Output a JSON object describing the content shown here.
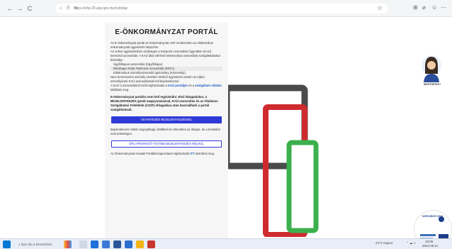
{
  "browser": {
    "back": "←",
    "forward": "→",
    "reload": "C",
    "url": "https://ohp-20.asp.lgov.hu/nyitolap",
    "addr_icons": "⌂ ⓐ ≡"
  },
  "card": {
    "title": "E-ÖNKORMÁNYZAT PORTÁL",
    "intro": "Az E-önkormányzat portál az önkormányzati ASP rendszerben az elektronikus önkormányzati ügyintézés helyszíne.",
    "auth_intro": "Az online ügyintézéshez szükséges a Központi Azonosítási Ügynökön (KAÜ) keresztül azonosítás. A KAÜ által elérhető elektronikus azonosítási szolgáltatásokat biztosítja:",
    "methods": [
      "Ügyfélkapus azonosítás (Ügyfélkapu)",
      "Részleges Kódú Telefonos Azonosítás (RKTA)",
      "Elektronikus személyazonosító igazolvány (eSzemélyi)."
    ],
    "note": "Nem természetes személy nevében történő ügyintézés esetén az eljáró személyének KAÜ-azonosítással kell bejelentkeznie.",
    "kau_info_prefix": "A KAÜ-s azonosításról szóló tájékoztatás a",
    "kau_link1": "KAÜ portálján",
    "kau_mid": "és a",
    "kau_link2": "szolgáltató oldalán",
    "kau_suffix": "található meg.",
    "bold_notice": "E-önkormányzat portálra nem kell regisztrálni. Első látogatáskor, a BEJELENTKEZÉS gomb megnyomásával, KAÜ azonosítás és az Általános Szolgáltatási Feltételek (ÁSZF) elfogadása után használható a portál szolgáltatásait.",
    "login_button": "ÜGYINTÉZÉS BEJELENTKEZÉSSEL",
    "no_login_text": "Bejelentkezés nélkül megnyithatja, kitöltheti és elmentheti az űrlapot, de a beküldés nem lehetséges.",
    "no_login_button": "ŰRLAPKERESŐ TOVÁBB BEJELENTKEZÉS NÉLKÜL",
    "footer_prefix": "Az Önkormányzati Hivatali Portállal kapcsolatos tájékoztatót",
    "footer_link": "ITT",
    "footer_suffix": "tekintheti meg."
  },
  "assistant": {
    "label": "SEGÍTHETEK?"
  },
  "logo": {
    "label": "SZÉCHENYI 2020"
  },
  "taskbar": {
    "search_placeholder": "Írjon ide a kereséshez",
    "weather": "24°C Napos",
    "time": "10:05",
    "date": "2022.08.11."
  },
  "colors": {
    "accent": "#2f3ad6",
    "tablet": "#cf2b2f",
    "phone": "#3bb04c",
    "laptop": "#4a4a4a"
  }
}
